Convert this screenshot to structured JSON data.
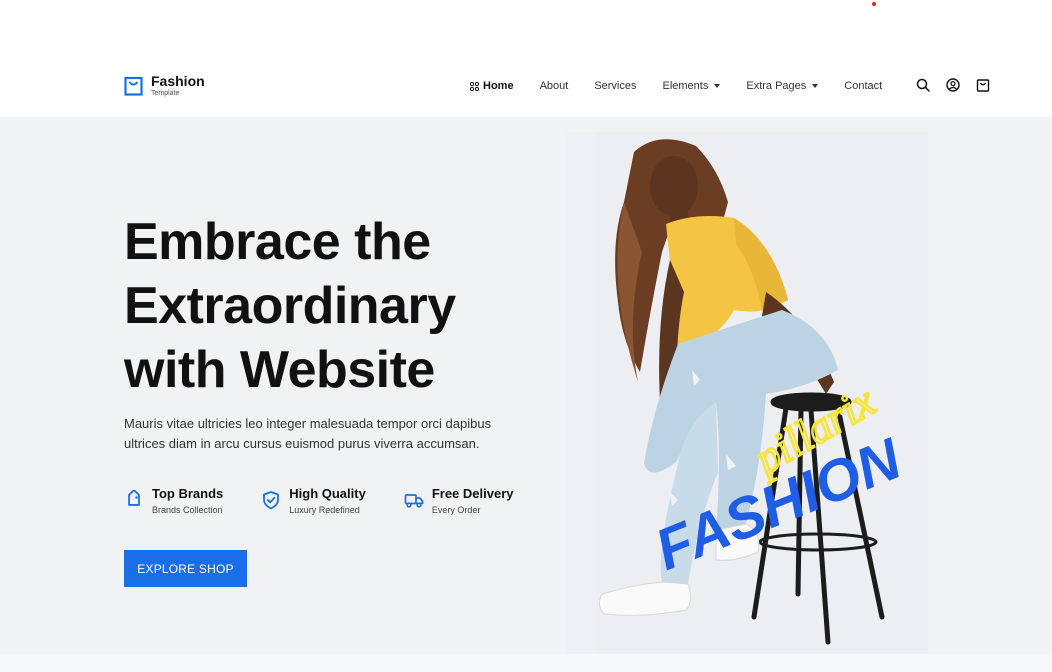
{
  "brand": {
    "name": "Fashion",
    "tagline": "Template"
  },
  "nav": {
    "items": [
      {
        "label": "Home",
        "active": true
      },
      {
        "label": "About"
      },
      {
        "label": "Services"
      },
      {
        "label": "Elements",
        "dropdown": true
      },
      {
        "label": "Extra Pages",
        "dropdown": true
      },
      {
        "label": "Contact"
      }
    ],
    "icons": [
      "search-icon",
      "user-icon",
      "cart-icon"
    ]
  },
  "hero": {
    "headline": [
      "Embrace the",
      "Extraordinary",
      "with Website"
    ],
    "description": "Mauris vitae ultricies leo integer malesuada tempor orci dapibus ultrices diam in arcu cursus euismod purus viverra accumsan.",
    "features": [
      {
        "icon": "tag-icon",
        "title": "Top Brands",
        "subtitle": "Brands Collection"
      },
      {
        "icon": "shield-check-icon",
        "title": "High Quality",
        "subtitle": "Luxury Redefined"
      },
      {
        "icon": "truck-icon",
        "title": "Free Delivery",
        "subtitle": "Every Order"
      }
    ],
    "cta_label": "EXPLORE SHOP",
    "image_text": {
      "script": "pillarix",
      "word": "FASHION"
    }
  },
  "colors": {
    "accent": "#1a6fe8",
    "hero_bg": "#f1f2f4",
    "script_yellow": "#f7e43a",
    "shirt": "#f4c542",
    "jeans": "#bcd3e3"
  }
}
